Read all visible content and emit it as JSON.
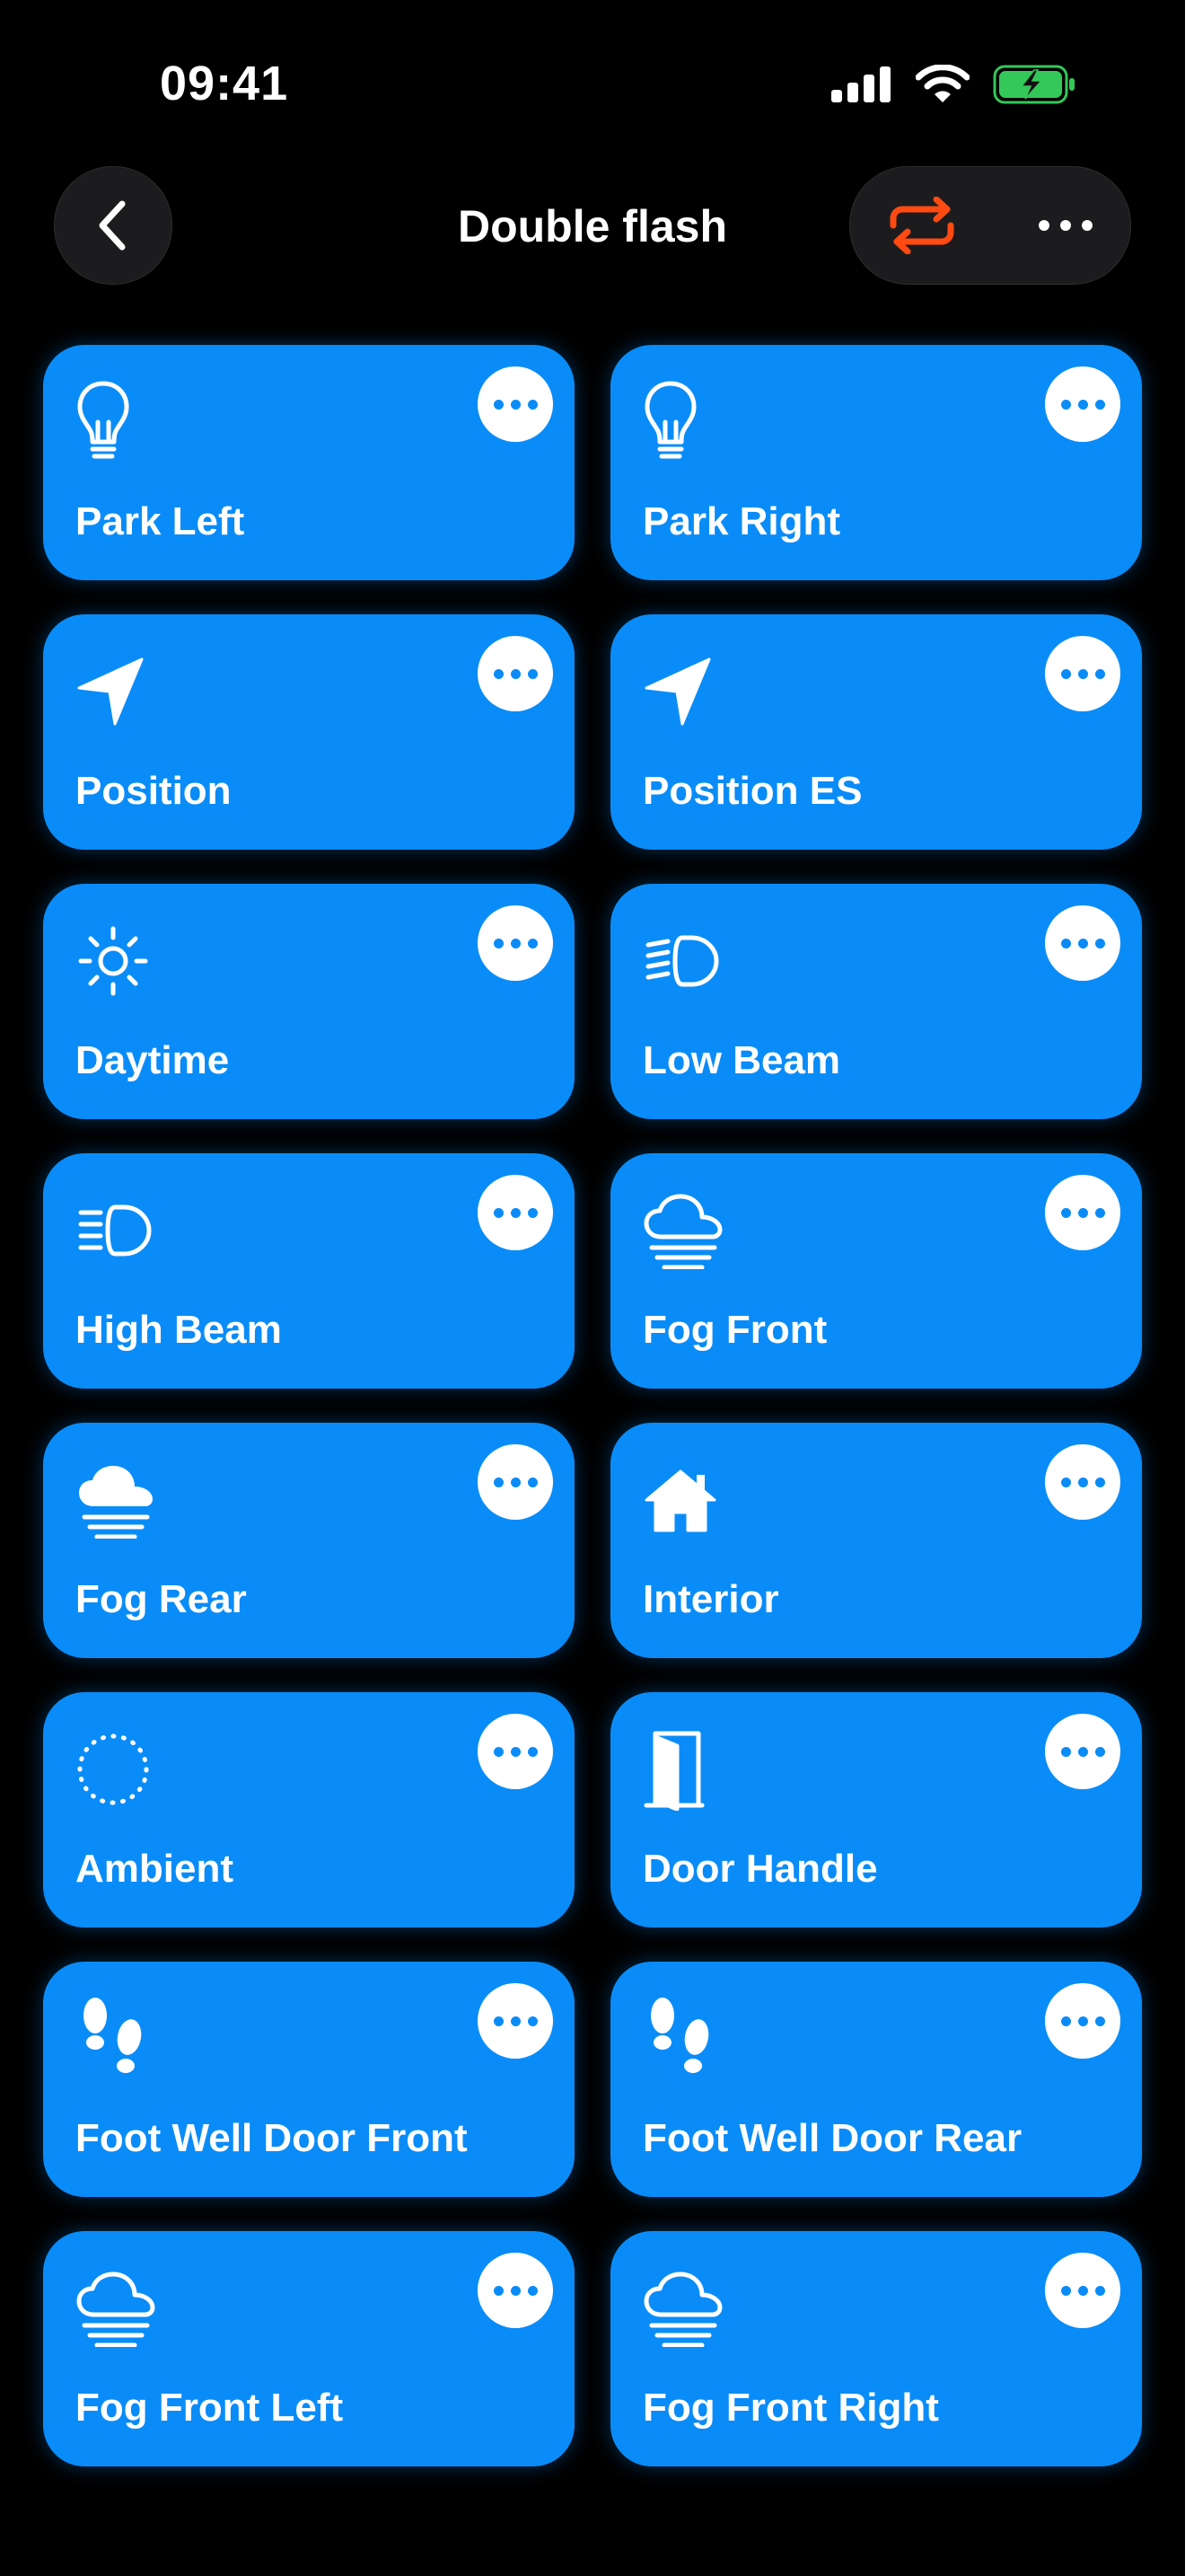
{
  "status": {
    "time": "09:41"
  },
  "nav": {
    "title": "Double flash"
  },
  "colors": {
    "accent": "#0a8cf8",
    "loop": "#ff4a12",
    "battery": "#34c759"
  },
  "tiles": [
    {
      "label": "Park Left",
      "icon": "lightbulb-icon"
    },
    {
      "label": "Park Right",
      "icon": "lightbulb-icon"
    },
    {
      "label": "Position",
      "icon": "location-arrow-icon"
    },
    {
      "label": "Position ES",
      "icon": "location-arrow-icon"
    },
    {
      "label": "Daytime",
      "icon": "sun-icon"
    },
    {
      "label": "Low Beam",
      "icon": "low-beam-icon"
    },
    {
      "label": "High Beam",
      "icon": "high-beam-icon"
    },
    {
      "label": "Fog Front",
      "icon": "cloud-fog-icon"
    },
    {
      "label": "Fog Rear",
      "icon": "cloud-fog-filled-icon"
    },
    {
      "label": "Interior",
      "icon": "house-icon"
    },
    {
      "label": "Ambient",
      "icon": "dotted-circle-icon"
    },
    {
      "label": "Door Handle",
      "icon": "door-icon"
    },
    {
      "label": "Foot Well Door Front",
      "icon": "footprints-icon"
    },
    {
      "label": "Foot Well Door Rear",
      "icon": "footprints-icon"
    },
    {
      "label": "Fog Front Left",
      "icon": "cloud-fog-icon"
    },
    {
      "label": "Fog Front Right",
      "icon": "cloud-fog-icon"
    }
  ]
}
